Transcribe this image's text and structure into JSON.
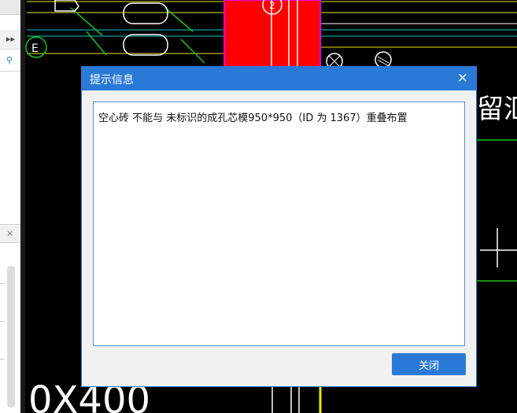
{
  "left_panel": {
    "expand_glyph": "▸▸",
    "search_icon": "search-icon",
    "close_glyph": "×"
  },
  "cad": {
    "text_right": "留汇",
    "text_bottom": "0X400",
    "marker_label": "E",
    "top_label": "2",
    "colors": {
      "background": "#000000",
      "red_fill": "#ff0000",
      "magenta": "#e000e0",
      "yellow": "#e8e800",
      "green": "#18c418",
      "cyan": "#00c8c8",
      "white": "#ffffff"
    }
  },
  "dialog": {
    "title": "提示信息",
    "close_glyph": "×",
    "message": "空心砖 不能与 未标识的成孔芯模950*950（ID 为 1367）重叠布置",
    "close_button_label": "关闭",
    "accent_color": "#2b79d6"
  }
}
